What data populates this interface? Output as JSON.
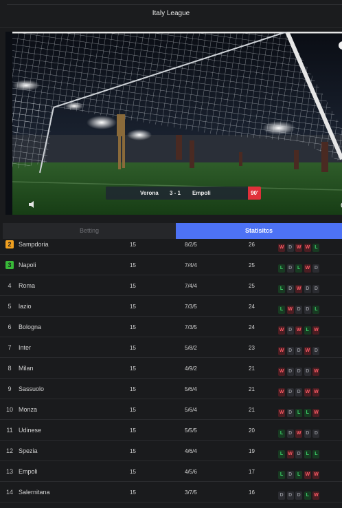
{
  "header": {
    "title": "Italy League"
  },
  "match": {
    "home": "Verona",
    "score": "3 - 1",
    "away": "Empoli",
    "minute": "90'"
  },
  "icons": {
    "alert": "!"
  },
  "tabs": [
    {
      "label": "Betting",
      "active": false
    },
    {
      "label": "Statisitcs",
      "active": true
    }
  ],
  "colors": {
    "accent": "#4d72f5",
    "win": "#ff5c66",
    "loss": "#3ed46a",
    "draw": "#8d8e94",
    "badge_2": "#f0a020",
    "badge_3": "#38b838",
    "minute_badge": "#e0303a"
  },
  "standings": [
    {
      "pos": "2",
      "team": "Sampdoria",
      "played": "15",
      "wdl": "8/2/5",
      "pts": "26",
      "form": [
        "W",
        "D",
        "W",
        "W",
        "L"
      ],
      "badge": "#f0a020"
    },
    {
      "pos": "3",
      "team": "Napoli",
      "played": "15",
      "wdl": "7/4/4",
      "pts": "25",
      "form": [
        "L",
        "D",
        "L",
        "W",
        "D"
      ],
      "badge": "#38b838"
    },
    {
      "pos": "4",
      "team": "Roma",
      "played": "15",
      "wdl": "7/4/4",
      "pts": "25",
      "form": [
        "L",
        "D",
        "W",
        "D",
        "D"
      ]
    },
    {
      "pos": "5",
      "team": "lazio",
      "played": "15",
      "wdl": "7/3/5",
      "pts": "24",
      "form": [
        "L",
        "W",
        "D",
        "D",
        "L"
      ]
    },
    {
      "pos": "6",
      "team": "Bologna",
      "played": "15",
      "wdl": "7/3/5",
      "pts": "24",
      "form": [
        "W",
        "D",
        "W",
        "L",
        "W"
      ]
    },
    {
      "pos": "7",
      "team": "Inter",
      "played": "15",
      "wdl": "5/8/2",
      "pts": "23",
      "form": [
        "W",
        "D",
        "D",
        "W",
        "D"
      ]
    },
    {
      "pos": "8",
      "team": "Milan",
      "played": "15",
      "wdl": "4/9/2",
      "pts": "21",
      "form": [
        "W",
        "D",
        "D",
        "D",
        "W"
      ]
    },
    {
      "pos": "9",
      "team": "Sassuolo",
      "played": "15",
      "wdl": "5/6/4",
      "pts": "21",
      "form": [
        "W",
        "D",
        "D",
        "W",
        "W"
      ]
    },
    {
      "pos": "10",
      "team": "Monza",
      "played": "15",
      "wdl": "5/6/4",
      "pts": "21",
      "form": [
        "W",
        "D",
        "L",
        "L",
        "W"
      ]
    },
    {
      "pos": "11",
      "team": "Udinese",
      "played": "15",
      "wdl": "5/5/5",
      "pts": "20",
      "form": [
        "L",
        "D",
        "W",
        "D",
        "D"
      ]
    },
    {
      "pos": "12",
      "team": "Spezia",
      "played": "15",
      "wdl": "4/6/4",
      "pts": "19",
      "form": [
        "L",
        "W",
        "D",
        "L",
        "L"
      ]
    },
    {
      "pos": "13",
      "team": "Empoli",
      "played": "15",
      "wdl": "4/5/6",
      "pts": "17",
      "form": [
        "L",
        "D",
        "L",
        "W",
        "W"
      ]
    },
    {
      "pos": "14",
      "team": "Salernitana",
      "played": "15",
      "wdl": "3/7/5",
      "pts": "16",
      "form": [
        "D",
        "D",
        "D",
        "L",
        "W"
      ]
    }
  ]
}
